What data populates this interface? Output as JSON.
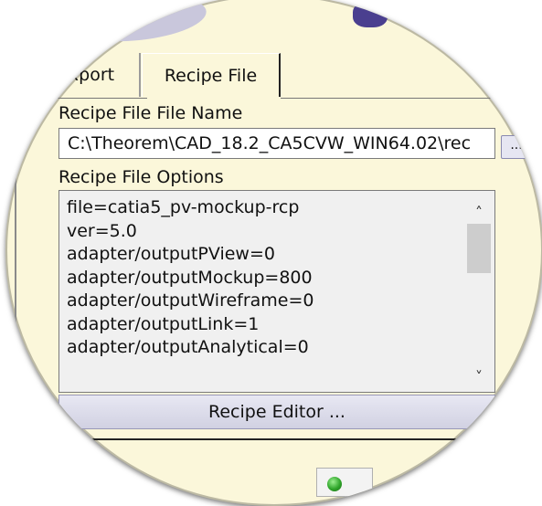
{
  "tabs": [
    {
      "label": "Export",
      "active": false
    },
    {
      "label": "Recipe File",
      "active": true
    }
  ],
  "recipe_file_name": {
    "label": "Recipe File File Name",
    "value": "C:\\Theorem\\CAD_18.2_CA5CVW_WIN64.02\\rec",
    "browse_label": "..."
  },
  "recipe_file_options": {
    "label": "Recipe File Options",
    "lines": [
      "file=catia5_pv-mockup-rcp",
      "ver=5.0",
      "adapter/outputPView=0",
      "adapter/outputMockup=800",
      "adapter/outputWireframe=0",
      "adapter/outputLink=1",
      "adapter/outputAnalytical=0"
    ]
  },
  "recipe_editor_button": "Recipe Editor ...",
  "icons": {
    "scroll_up": "chevron-up-icon",
    "scroll_down": "chevron-down-icon",
    "status": "green-status-icon"
  },
  "colors": {
    "panel_bg": "#fbf7da",
    "field_bg": "#ffffff",
    "list_bg": "#f0f0f0",
    "button_bg": "#d8d8e8",
    "status_green": "#2fa52a"
  }
}
